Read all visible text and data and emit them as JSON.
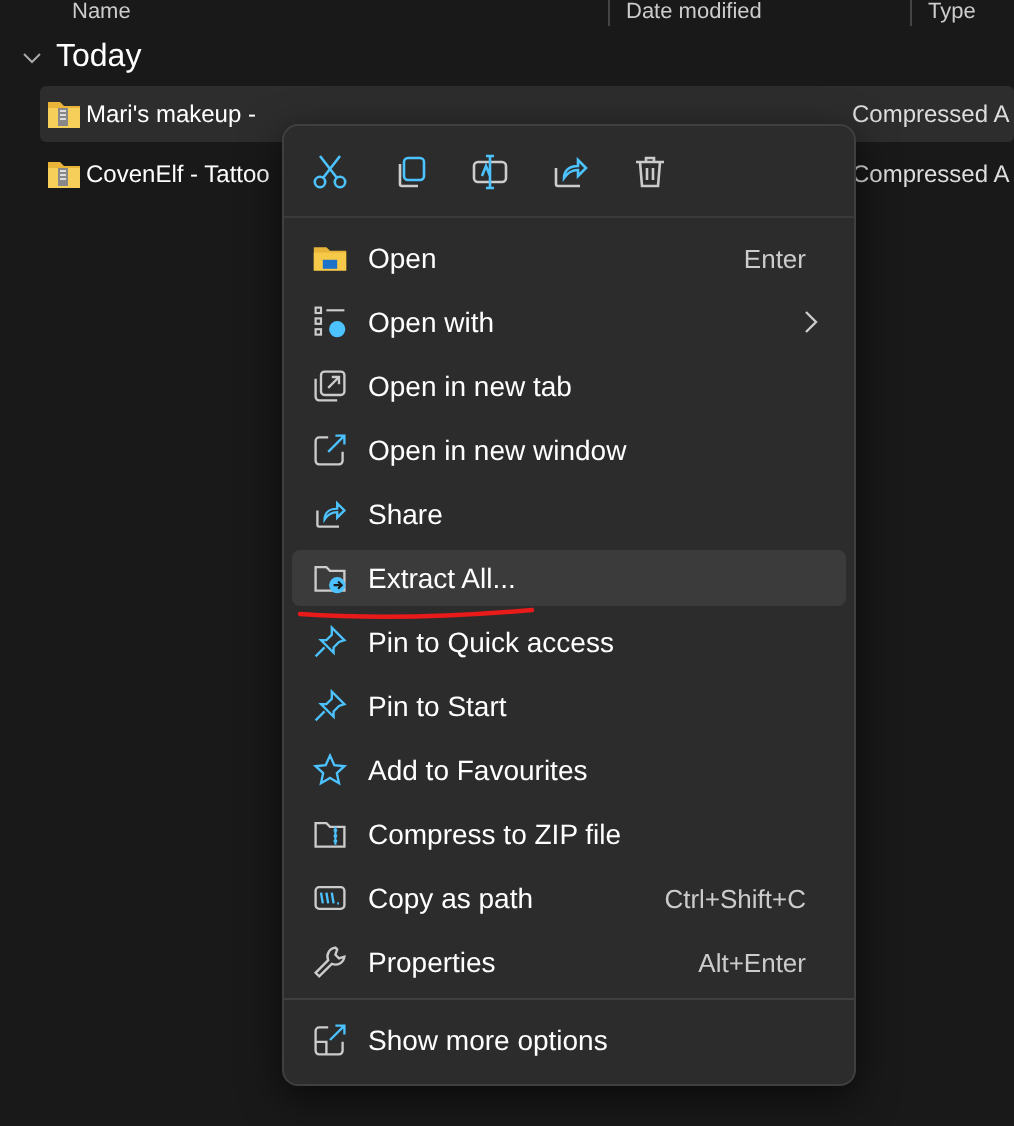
{
  "columns": [
    "Name",
    "Date modified",
    "Type"
  ],
  "group": {
    "label": "Today",
    "expanded": true
  },
  "files": [
    {
      "name": "Mari's makeup -",
      "type": "Compressed A",
      "selected": true
    },
    {
      "name": "CovenElf - Tattoo",
      "type": "Compressed A",
      "selected": false
    }
  ],
  "menu": {
    "items": [
      {
        "label": "Open",
        "shortcut": "Enter",
        "submenu": false,
        "selected": false
      },
      {
        "label": "Open with",
        "submenu": true,
        "selected": false
      },
      {
        "label": "Open in new tab",
        "submenu": false,
        "selected": false
      },
      {
        "label": "Open in new window",
        "submenu": false,
        "selected": false
      },
      {
        "label": "Share",
        "submenu": false,
        "selected": false
      },
      {
        "label": "Extract All...",
        "submenu": false,
        "selected": true
      },
      {
        "label": "Pin to Quick access",
        "submenu": false,
        "selected": false
      },
      {
        "label": "Pin to Start",
        "submenu": false,
        "selected": false
      },
      {
        "label": "Add to Favourites",
        "submenu": false,
        "selected": false
      },
      {
        "label": "Compress to ZIP file",
        "submenu": false,
        "selected": false
      },
      {
        "label": "Copy as path",
        "shortcut": "Ctrl+Shift+C",
        "submenu": false,
        "selected": false
      },
      {
        "label": "Properties",
        "shortcut": "Alt+Enter",
        "submenu": false,
        "selected": false
      }
    ],
    "footer": {
      "label": "Show more options"
    }
  }
}
